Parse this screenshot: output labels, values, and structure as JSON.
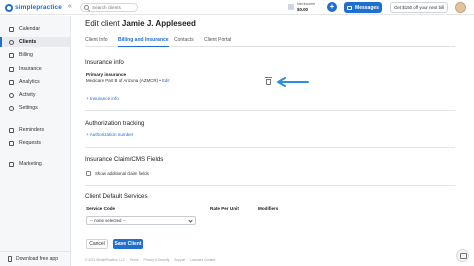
{
  "topbar": {
    "logo_text": "simplepractice",
    "collapse_glyph": "«",
    "search_placeholder": "Search clients",
    "income_label": "Net income",
    "income_value": "$0.00",
    "plus_glyph": "+",
    "messages_label": "Messages",
    "referral_label": "Get $150 off your next bill"
  },
  "sidebar": {
    "items": [
      {
        "label": "Calendar",
        "icon": "calendar-icon"
      },
      {
        "label": "Clients",
        "icon": "clients-icon"
      },
      {
        "label": "Billing",
        "icon": "billing-icon"
      },
      {
        "label": "Insurance",
        "icon": "insurance-icon"
      },
      {
        "label": "Analytics",
        "icon": "analytics-icon"
      },
      {
        "label": "Activity",
        "icon": "activity-icon"
      },
      {
        "label": "Settings",
        "icon": "settings-icon"
      },
      {
        "label": "Reminders",
        "icon": "reminders-icon"
      },
      {
        "label": "Requests",
        "icon": "requests-icon"
      },
      {
        "label": "Marketing",
        "icon": "marketing-icon"
      }
    ],
    "active_item": "Clients",
    "download_label": "Download free app"
  },
  "page": {
    "title_prefix": "Edit client",
    "client_name": "Jamie J. Appleseed",
    "tabs": [
      "Client Info",
      "Billing and Insurance",
      "Contacts",
      "Client Portal"
    ],
    "active_tab": "Billing and Insurance"
  },
  "insurance": {
    "heading": "Insurance info",
    "primary_label": "Primary insurance",
    "primary_value": "Medicare Part B of Arizona (AZMCR)",
    "separator": "•",
    "edit_link": "Edit",
    "add_link": "+ Insurance info"
  },
  "authorization": {
    "heading": "Authorization tracking",
    "add_link": "+ Authorization number"
  },
  "claim": {
    "heading": "Insurance Claim/CMS Fields",
    "checkbox_label": "Show additional claim fields"
  },
  "services": {
    "heading": "Client Default Services",
    "col_service_code": "Service Code",
    "col_rate": "Rate Per Unit",
    "col_modifiers": "Modifiers",
    "select_value": "-- none selected --"
  },
  "actions": {
    "cancel_label": "Cancel",
    "save_label": "Save Client"
  },
  "footer": {
    "items": [
      "© 2021 SimplePractice, LLC",
      "Terms",
      "Privacy & Security",
      "Support",
      "Licensed Content"
    ]
  },
  "colors": {
    "accent": "#1f6fd1",
    "sidebar_bg": "#f6f7f9"
  }
}
